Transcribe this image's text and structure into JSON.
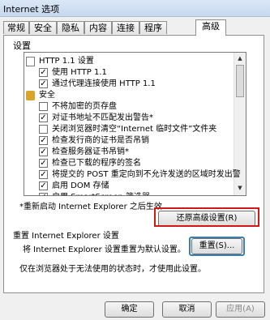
{
  "window": {
    "title": "Internet 选项"
  },
  "tabs": [
    "常规",
    "安全",
    "隐私",
    "内容",
    "连接",
    "程序",
    "高级"
  ],
  "panel": {
    "settings_label": "设置"
  },
  "list": [
    {
      "type": "category",
      "icon": "document-icon",
      "label": "HTTP 1.1 设置"
    },
    {
      "type": "item",
      "checked": true,
      "label": "使用 HTTP 1.1"
    },
    {
      "type": "item",
      "checked": true,
      "label": "通过代理连接使用 HTTP 1.1"
    },
    {
      "type": "category",
      "icon": "lock-icon",
      "label": "安全"
    },
    {
      "type": "item",
      "checked": false,
      "label": "不将加密的页存盘"
    },
    {
      "type": "item",
      "checked": true,
      "label": "对证书地址不匹配发出警告*"
    },
    {
      "type": "item",
      "checked": false,
      "label": "关闭浏览器时清空“Internet 临时文件”文件夹"
    },
    {
      "type": "item",
      "checked": true,
      "label": "检查发行商的证书是否吊销"
    },
    {
      "type": "item",
      "checked": true,
      "label": "检查服务器证书吊销*"
    },
    {
      "type": "item",
      "checked": true,
      "label": "检查已下载的程序的签名"
    },
    {
      "type": "item",
      "checked": true,
      "label": "将提交的 POST 重定向到不允许发送的区域时发出警"
    },
    {
      "type": "item",
      "checked": true,
      "label": "启用 DOM 存储"
    },
    {
      "type": "item",
      "checked": true,
      "label": "启用 SmartScreen 筛选器"
    }
  ],
  "notes": {
    "restart": "*重新启动 Internet Explorer 之后生效"
  },
  "buttons": {
    "restore_advanced": "还原高级设置(R)",
    "reset": "重置(S)...",
    "ok": "确定",
    "cancel": "取消",
    "apply": "应用(A)"
  },
  "reset_group": {
    "title": "重置 Internet Explorer 设置",
    "description": "将 Internet Explorer 设置重置为默认设置。",
    "note": "仅在浏览器处于无法使用的状态时，才使用此设置。"
  }
}
